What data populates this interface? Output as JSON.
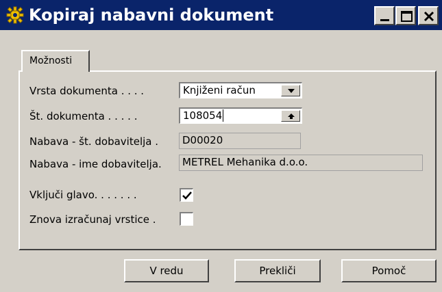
{
  "window": {
    "title": "Kopiraj nabavni dokument",
    "titlebar_color": "#0a246a",
    "controls": {
      "minimize": "minimize-icon",
      "maximize": "maximize-icon",
      "close": "close-icon"
    }
  },
  "tabs": [
    {
      "label": "Možnosti",
      "active": true
    }
  ],
  "form": {
    "doc_type": {
      "label": "Vrsta dokumenta . . . .",
      "value": "Knjiženi račun",
      "icon": "dropdown-arrow-icon"
    },
    "doc_number": {
      "label": "Št. dokumenta . . . . .",
      "value": "108054",
      "icon": "lookup-arrow-icon"
    },
    "vendor_no": {
      "label": "Nabava - št. dobavitelja .",
      "value": "D00020"
    },
    "vendor_name": {
      "label": "Nabava - ime dobavitelja.",
      "value": "METREL Mehanika d.o.o."
    },
    "include_header": {
      "label": "Vključi glavo. . . . . . .",
      "checked": true
    },
    "recalc_lines": {
      "label": "Znova izračunaj vrstice .",
      "checked": false
    }
  },
  "buttons": {
    "ok": "V redu",
    "cancel": "Prekliči",
    "help": "Pomoč"
  }
}
